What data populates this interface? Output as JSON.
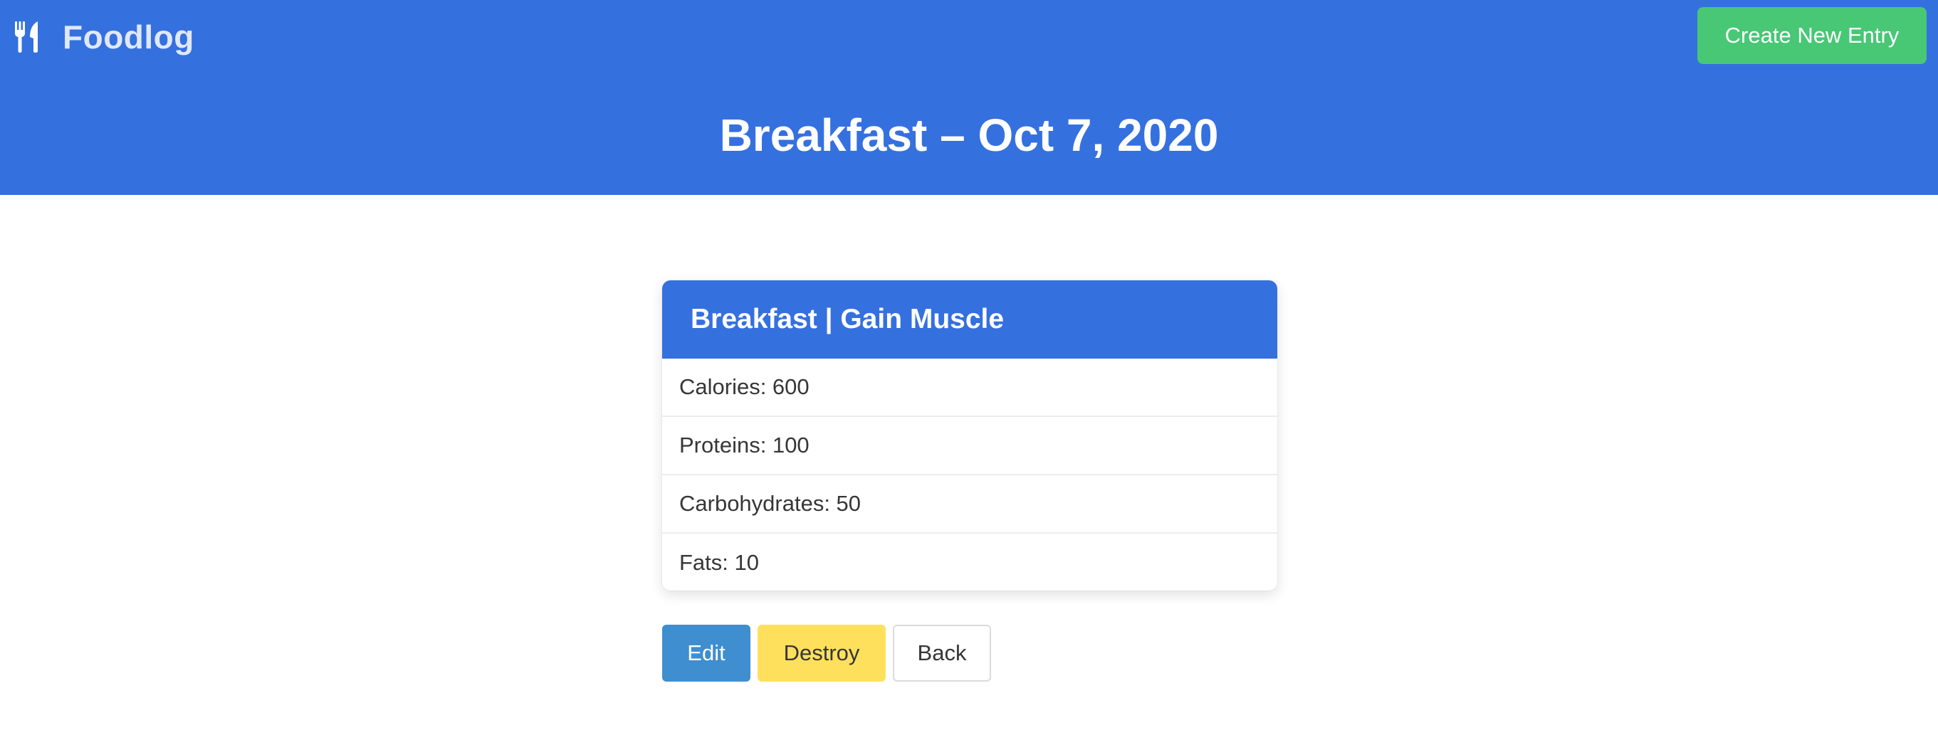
{
  "navbar": {
    "brand_icon": "utensils-icon",
    "brand_name": "Foodlog",
    "create_button": "Create New Entry"
  },
  "hero": {
    "title": "Breakfast – Oct 7, 2020"
  },
  "card": {
    "header": "Breakfast | Gain Muscle",
    "rows": [
      {
        "label": "Calories",
        "value": "600",
        "text": "Calories: 600"
      },
      {
        "label": "Proteins",
        "value": "100",
        "text": "Proteins: 100"
      },
      {
        "label": "Carbohydrates",
        "value": "50",
        "text": "Carbohydrates: 50"
      },
      {
        "label": "Fats",
        "value": "10",
        "text": "Fats: 10"
      }
    ]
  },
  "actions": {
    "edit": "Edit",
    "destroy": "Destroy",
    "back": "Back"
  },
  "colors": {
    "primary": "#3570df",
    "success": "#48c774",
    "info": "#3e8ed0",
    "warning": "#ffe05d"
  }
}
